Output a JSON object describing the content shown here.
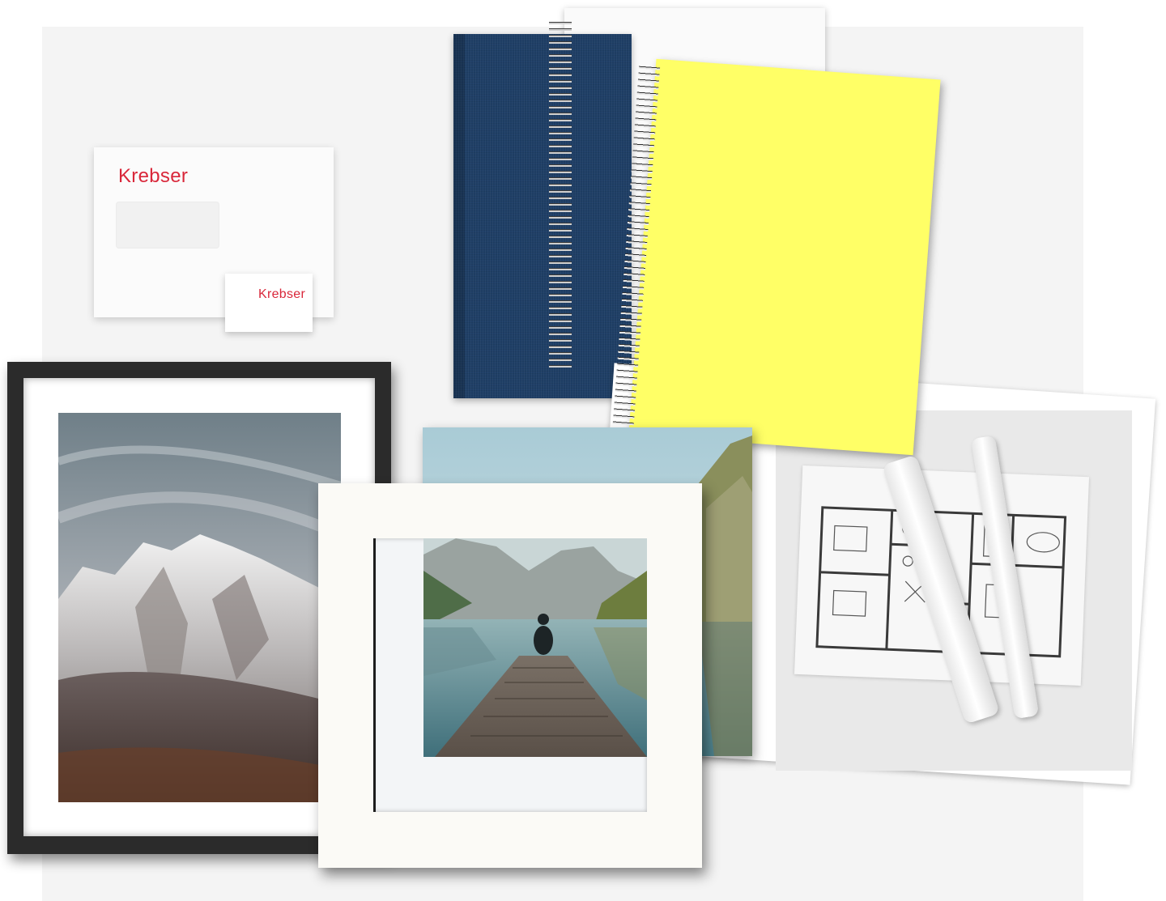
{
  "brand": {
    "envelope_logo": "Krebser",
    "card_logo": "Krebser",
    "color": "#d9273a"
  },
  "products": {
    "notebook_navy_color": "#1f3f66",
    "notebook_yellow_color": "#ffff66",
    "frame_black_color": "#2b2b2b",
    "frame_white_color": "#fbfaf6"
  }
}
